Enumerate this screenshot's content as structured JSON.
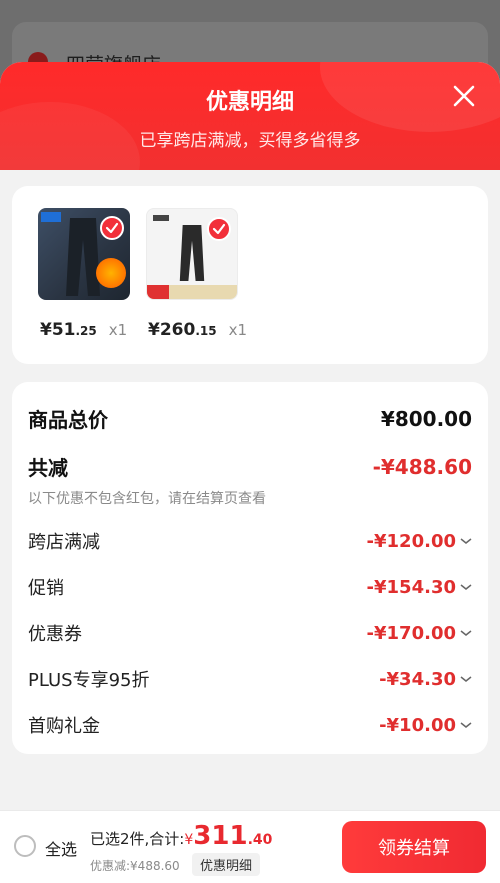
{
  "background": {
    "shop_name": "四营旗舰店"
  },
  "sheet": {
    "title": "优惠明细",
    "subtitle": "已享跨店满减，买得多省得多",
    "close_icon": "close-icon"
  },
  "products": [
    {
      "image": "jeans-fleece-product",
      "price_int": "¥51",
      "price_dec": ".25",
      "qty": "x1",
      "selected": true
    },
    {
      "image": "black-pants-product",
      "price_int": "¥260",
      "price_dec": ".15",
      "qty": "x1",
      "selected": true
    }
  ],
  "details": {
    "total_label": "商品总价",
    "total_value": "¥800.00",
    "discount_label": "共减",
    "discount_value": "-¥488.60",
    "hint": "以下优惠不包含红包，请在结算页查看",
    "items": [
      {
        "label": "跨店满减",
        "value": "-¥120.00"
      },
      {
        "label": "促销",
        "value": "-¥154.30"
      },
      {
        "label": "优惠券",
        "value": "-¥170.00"
      },
      {
        "label": "PLUS专享95折",
        "value": "-¥34.30"
      },
      {
        "label": "首购礼金",
        "value": "-¥10.00"
      }
    ]
  },
  "bottom_bar": {
    "select_all": "全选",
    "selected_text": "已选2件,合计:",
    "currency": "¥",
    "total_int": "311",
    "total_dec": ".40",
    "saved_text": "优惠减:¥488.60",
    "detail_chip": "优惠明细",
    "checkout_label": "领券结算"
  },
  "colors": {
    "accent": "#f2303a",
    "header": "#ff2a2a"
  }
}
